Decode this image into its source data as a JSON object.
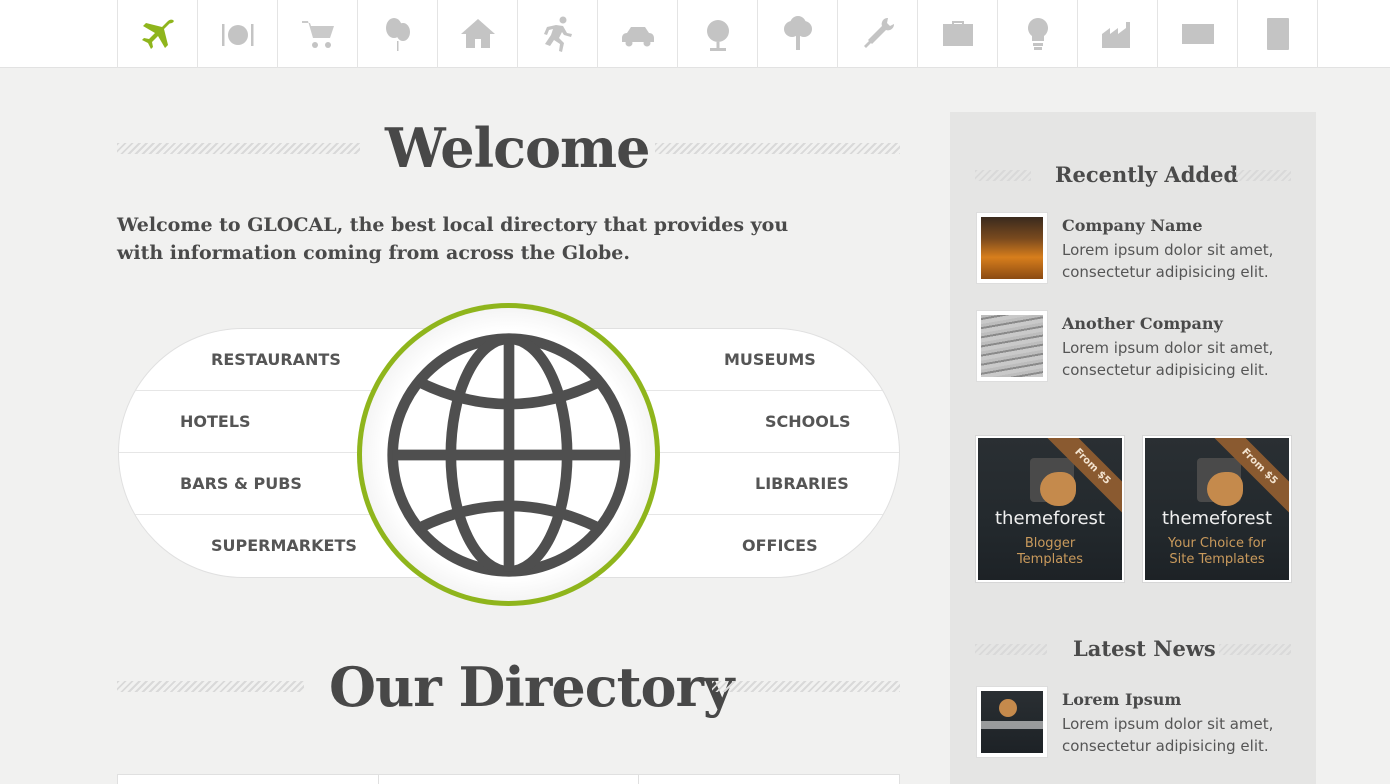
{
  "nav": {
    "items": [
      {
        "icon": "airplane-icon",
        "active": true
      },
      {
        "icon": "plate-cutlery-icon"
      },
      {
        "icon": "shopping-cart-icon"
      },
      {
        "icon": "balloons-icon"
      },
      {
        "icon": "house-icon"
      },
      {
        "icon": "running-man-icon"
      },
      {
        "icon": "car-icon"
      },
      {
        "icon": "desk-globe-icon"
      },
      {
        "icon": "tree-icon"
      },
      {
        "icon": "tools-icon"
      },
      {
        "icon": "briefcase-icon"
      },
      {
        "icon": "lightbulb-icon"
      },
      {
        "icon": "factory-icon"
      },
      {
        "icon": "envelope-icon"
      },
      {
        "icon": "book-icon"
      }
    ],
    "active_color": "#8fb51c",
    "icon_color": "#c4c4c4"
  },
  "welcome": {
    "title": "Welcome",
    "intro": "Welcome to GLOCAL, the best local directory that provides you with information coming from across the Globe."
  },
  "categories": {
    "left": [
      "RESTAURANTS",
      "HOTELS",
      "BARS & PUBS",
      "SUPERMARKETS"
    ],
    "right": [
      "MUSEUMS",
      "SCHOOLS",
      "LIBRARIES",
      "OFFICES"
    ],
    "globe_icon": "globe-icon",
    "accent": "#8fb51c"
  },
  "directory": {
    "title": "Our Directory"
  },
  "sidebar": {
    "recent": {
      "title": "Recently Added",
      "items": [
        {
          "title": "Company Name",
          "text": "Lorem ipsum dolor sit amet, consectetur adipisicing elit."
        },
        {
          "title": "Another Company",
          "text": "Lorem ipsum dolor sit amet, consectetur adipisicing elit."
        }
      ]
    },
    "ads": [
      {
        "ribbon": "From $5",
        "brand": "themeforest",
        "sub": "Blogger Templates"
      },
      {
        "ribbon": "From $5",
        "brand": "themeforest",
        "sub": "Your Choice for Site Templates"
      }
    ],
    "news": {
      "title": "Latest News",
      "items": [
        {
          "title": "Lorem Ipsum",
          "text": "Lorem ipsum dolor sit amet, consectetur adipisicing elit."
        }
      ]
    }
  }
}
